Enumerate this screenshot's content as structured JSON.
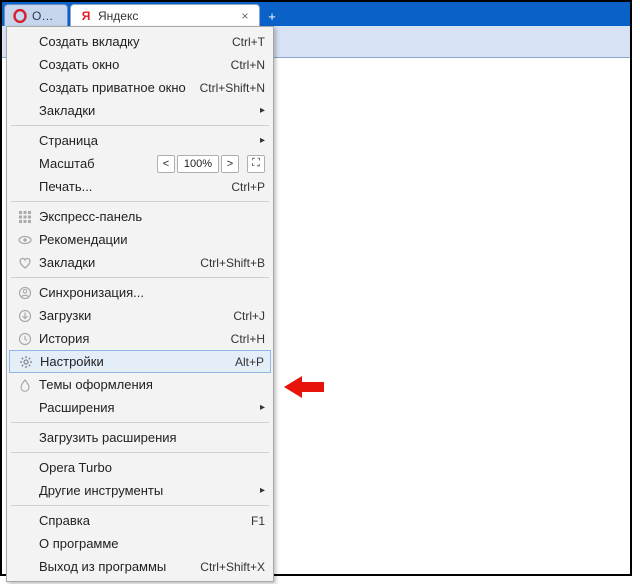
{
  "tabs": {
    "opera": {
      "label": "Opera"
    },
    "yandex": {
      "label": "Яндекс",
      "favicon_letter": "Я"
    },
    "newtab_symbol": "+"
  },
  "menu": {
    "new_tab": {
      "label": "Создать вкладку",
      "shortcut": "Ctrl+T"
    },
    "new_window": {
      "label": "Создать окно",
      "shortcut": "Ctrl+N"
    },
    "new_private": {
      "label": "Создать приватное окно",
      "shortcut": "Ctrl+Shift+N"
    },
    "bookmarks_sub": {
      "label": "Закладки"
    },
    "page_sub": {
      "label": "Страница"
    },
    "zoom": {
      "label": "Масштаб",
      "value": "100%",
      "dec": "<",
      "inc": ">",
      "full": "⛶"
    },
    "print": {
      "label": "Печать...",
      "shortcut": "Ctrl+P"
    },
    "speed_dial": {
      "label": "Экспресс-панель"
    },
    "recs": {
      "label": "Рекомендации"
    },
    "bookmarks": {
      "label": "Закладки",
      "shortcut": "Ctrl+Shift+B"
    },
    "sync": {
      "label": "Синхронизация..."
    },
    "downloads": {
      "label": "Загрузки",
      "shortcut": "Ctrl+J"
    },
    "history": {
      "label": "История",
      "shortcut": "Ctrl+H"
    },
    "settings": {
      "label": "Настройки",
      "shortcut": "Alt+P"
    },
    "themes": {
      "label": "Темы оформления"
    },
    "extensions_sub": {
      "label": "Расширения"
    },
    "get_ext": {
      "label": "Загрузить расширения"
    },
    "turbo": {
      "label": "Opera Turbo"
    },
    "other_tools": {
      "label": "Другие инструменты"
    },
    "help": {
      "label": "Справка",
      "shortcut": "F1"
    },
    "about": {
      "label": "О программе"
    },
    "exit": {
      "label": "Выход из программы",
      "shortcut": "Ctrl+Shift+X"
    }
  }
}
